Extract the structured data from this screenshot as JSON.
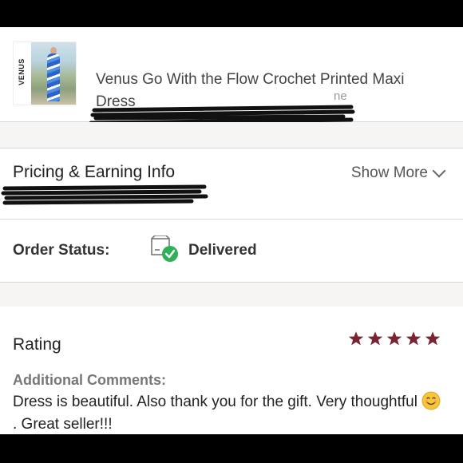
{
  "product": {
    "brand": "VENUS",
    "title": "Venus Go With the Flow Crochet Printed Maxi Dress",
    "subtitle_partial": "ne"
  },
  "pricing": {
    "title": "Pricing & Earning Info",
    "show_more_label": "Show More"
  },
  "order": {
    "status_label": "Order Status:",
    "status_value": "Delivered"
  },
  "rating": {
    "label": "Rating",
    "stars": 5,
    "max_stars": 5,
    "star_color": "#7a2433",
    "comments_label": "Additional Comments:",
    "comment_part1": "Dress is beautiful. Also thank you for the gift. Very thoughtful",
    "comment_part2": ". Great seller!!!"
  },
  "colors": {
    "accent_star": "#7a2433",
    "check_green": "#2fb15a"
  },
  "icons": {
    "chevron": "chevron-down-icon",
    "status": "delivered-box-check-icon",
    "emoji": "smiling-face-emoji"
  }
}
